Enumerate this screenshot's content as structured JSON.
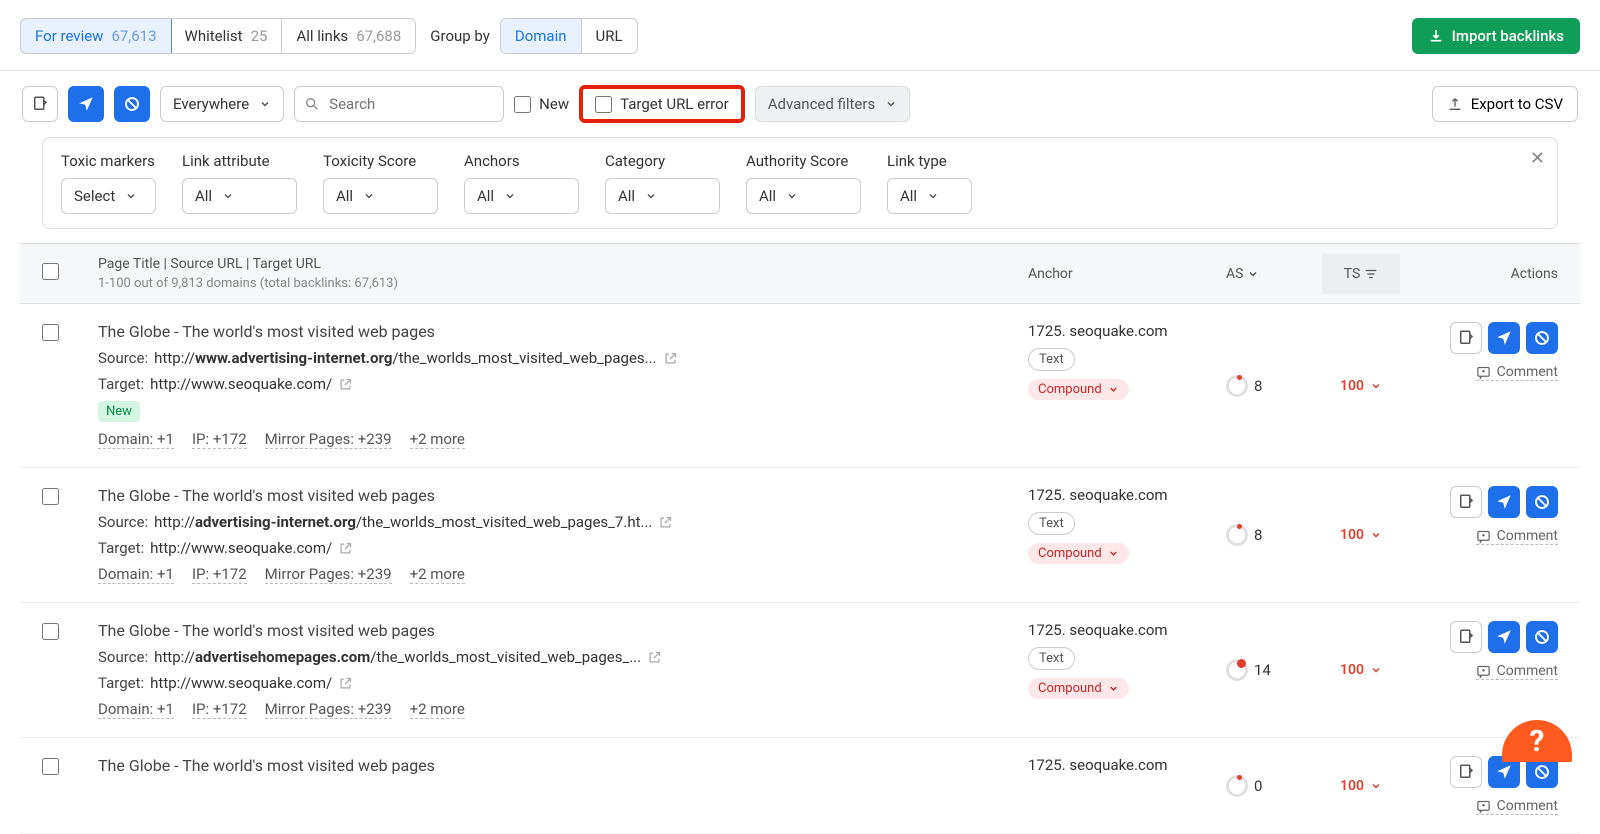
{
  "tabs": {
    "review_label": "For review",
    "review_count": "67,613",
    "whitelist_label": "Whitelist",
    "whitelist_count": "25",
    "all_label": "All links",
    "all_count": "67,688"
  },
  "group_by": {
    "label": "Group by",
    "opt_domain": "Domain",
    "opt_url": "URL"
  },
  "import_btn": "Import backlinks",
  "toolbar": {
    "everywhere": "Everywhere",
    "search_placeholder": "Search",
    "new_label": "New",
    "target_error": "Target URL error",
    "adv_filters": "Advanced filters",
    "export_csv": "Export to CSV"
  },
  "filters": {
    "toxic": {
      "label": "Toxic markers",
      "value": "Select"
    },
    "link_attr": {
      "label": "Link attribute",
      "value": "All"
    },
    "tox_score": {
      "label": "Toxicity Score",
      "value": "All"
    },
    "anchors": {
      "label": "Anchors",
      "value": "All"
    },
    "category": {
      "label": "Category",
      "value": "All"
    },
    "auth_score": {
      "label": "Authority Score",
      "value": "All"
    },
    "link_type": {
      "label": "Link type",
      "value": "All"
    }
  },
  "table": {
    "header_main": "Page Title | Source URL | Target URL",
    "header_sub": "1-100 out of 9,813 domains (total backlinks: 67,613)",
    "header_anchor": "Anchor",
    "header_as": "AS",
    "header_ts": "TS",
    "header_actions": "Actions"
  },
  "rows": [
    {
      "title": "The Globe - The world's most visited web pages",
      "source_label": "Source:",
      "source_prefix": "http://",
      "source_bold": "www.advertising-internet.org",
      "source_path": "/the_worlds_most_visited_web_pages...",
      "target_label": "Target:",
      "target_url": "http://www.seoquake.com/",
      "badge": "New",
      "meta": [
        "Domain: +1",
        "IP: +172",
        "Mirror Pages: +239",
        "+2 more"
      ],
      "anchor": "1725. seoquake.com",
      "tag1": "Text",
      "tag2": "Compound",
      "as": "8",
      "ts": "100"
    },
    {
      "title": "The Globe - The world's most visited web pages",
      "source_label": "Source:",
      "source_prefix": "http://",
      "source_bold": "advertising-internet.org",
      "source_path": "/the_worlds_most_visited_web_pages_7.ht...",
      "target_label": "Target:",
      "target_url": "http://www.seoquake.com/",
      "badge": "",
      "meta": [
        "Domain: +1",
        "IP: +172",
        "Mirror Pages: +239",
        "+2 more"
      ],
      "anchor": "1725. seoquake.com",
      "tag1": "Text",
      "tag2": "Compound",
      "as": "8",
      "ts": "100"
    },
    {
      "title": "The Globe - The world's most visited web pages",
      "source_label": "Source:",
      "source_prefix": "http://",
      "source_bold": "advertisehomepages.com",
      "source_path": "/the_worlds_most_visited_web_pages_...",
      "target_label": "Target:",
      "target_url": "http://www.seoquake.com/",
      "badge": "",
      "meta": [
        "Domain: +1",
        "IP: +172",
        "Mirror Pages: +239",
        "+2 more"
      ],
      "anchor": "1725. seoquake.com",
      "tag1": "Text",
      "tag2": "Compound",
      "as": "14",
      "ts": "100"
    },
    {
      "title": "The Globe - The world's most visited web pages",
      "source_label": "",
      "source_prefix": "",
      "source_bold": "",
      "source_path": "",
      "target_label": "",
      "target_url": "",
      "badge": "",
      "meta": [],
      "anchor": "1725. seoquake.com",
      "tag1": "",
      "tag2": "",
      "as": "0",
      "ts": "100"
    }
  ],
  "comment_label": "Comment"
}
